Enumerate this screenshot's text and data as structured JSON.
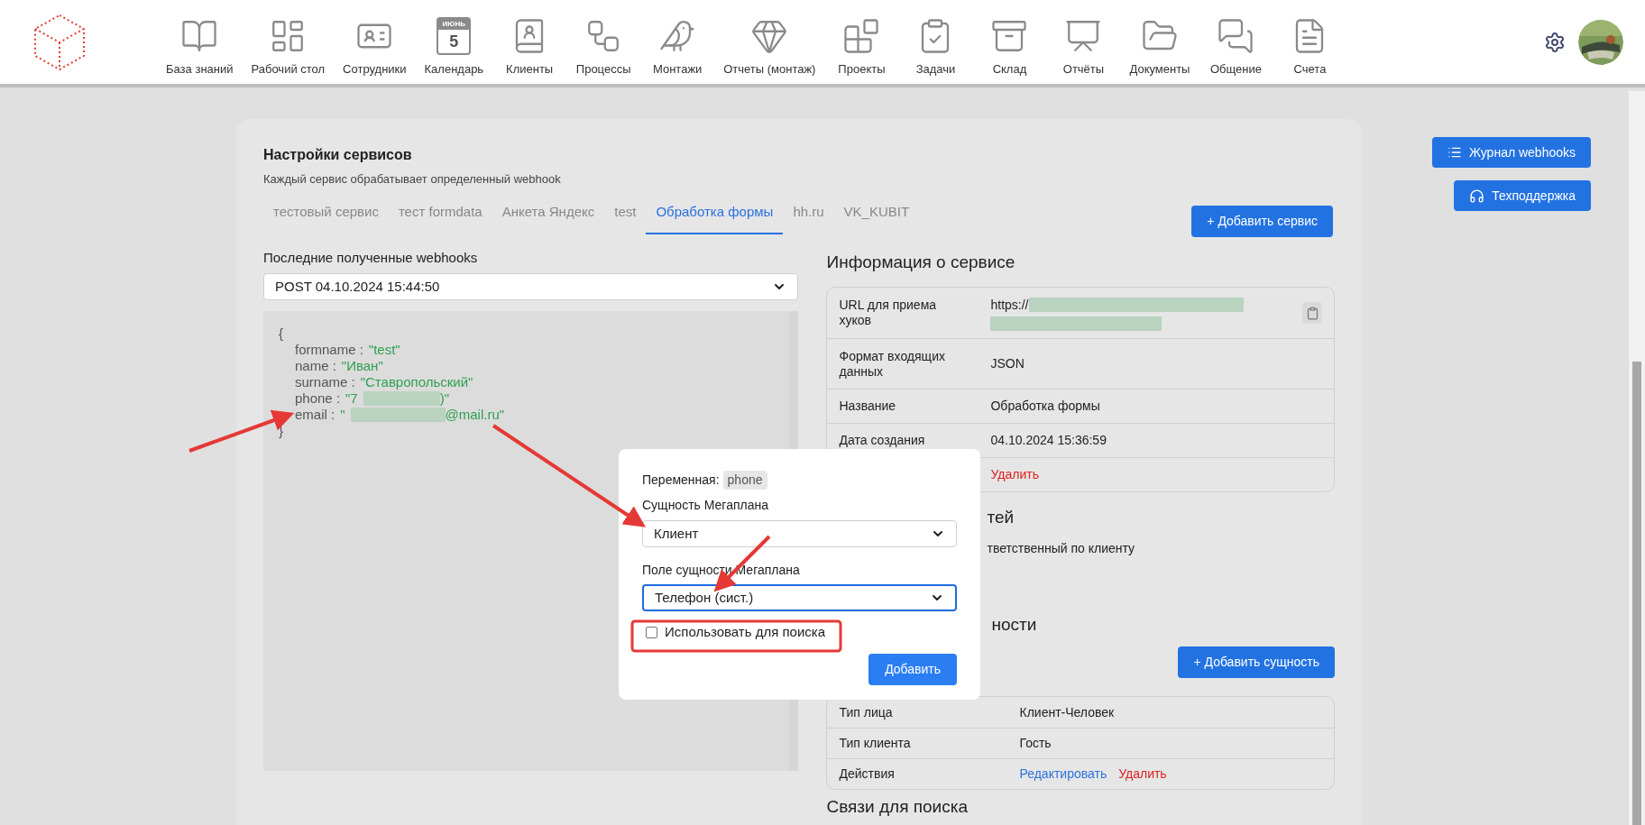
{
  "nav": {
    "items": [
      {
        "label": "База знаний"
      },
      {
        "label": "Рабочий стол"
      },
      {
        "label": "Сотрудники"
      },
      {
        "label": "Календарь",
        "month": "ИЮНЬ",
        "day": "5"
      },
      {
        "label": "Клиенты"
      },
      {
        "label": "Процессы"
      },
      {
        "label": "Монтажи"
      },
      {
        "label": "Отчеты (монтаж)"
      },
      {
        "label": "Проекты"
      },
      {
        "label": "Задачи"
      },
      {
        "label": "Склад"
      },
      {
        "label": "Отчёты"
      },
      {
        "label": "Документы"
      },
      {
        "label": "Общение"
      },
      {
        "label": "Счета"
      }
    ]
  },
  "page": {
    "title": "Настройки сервисов",
    "subtitle": "Каждый сервис обрабатывает определенный webhook",
    "tabs": [
      {
        "label": "тестовый сервис",
        "selected": false
      },
      {
        "label": "тест formdata",
        "selected": false
      },
      {
        "label": "Анкета Яндекс",
        "selected": false
      },
      {
        "label": "test",
        "selected": false
      },
      {
        "label": "Обработка формы",
        "selected": true
      },
      {
        "label": "hh.ru",
        "selected": false
      },
      {
        "label": "VK_KUBIT",
        "selected": false
      }
    ],
    "add_service_button": "+ Добавить сервис"
  },
  "webhooks": {
    "label": "Последние полученные webhooks",
    "selected": "POST 04.10.2024 15:44:50",
    "open": "{",
    "close": "}",
    "lines": [
      {
        "key": "formname :",
        "value": "\"test\"",
        "redacted": false
      },
      {
        "key": "name :",
        "value": "\"Иван\"",
        "redacted": false
      },
      {
        "key": "surname :",
        "value": "\"Ставропольский\"",
        "redacted": false
      },
      {
        "key": "phone :",
        "value": "\"7",
        "value_end": ")\"",
        "redacted": true
      },
      {
        "key": "email :",
        "value": "\"",
        "value_end": "@mail.ru\"",
        "redacted": true
      }
    ]
  },
  "service_info": {
    "title": "Информация о сервисе",
    "rows": [
      {
        "label": "URL для приема хуков",
        "value": "https://",
        "kind": "url"
      },
      {
        "label": "Формат входящих данных",
        "value": "JSON",
        "kind": "text"
      },
      {
        "label": "Название",
        "value": "Обработка формы",
        "kind": "text"
      },
      {
        "label": "Дата создания",
        "value": "04.10.2024 15:36:59",
        "kind": "text"
      },
      {
        "value": "Удалить",
        "kind": "delete"
      }
    ]
  },
  "fields_section": {
    "heading_fragment": "тей",
    "text_fragment": "тветственный по клиенту"
  },
  "entities_section": {
    "heading_fragment": "ности",
    "add_button": "+ Добавить сущность",
    "rows": [
      {
        "label": "Тип лица",
        "value": "Клиент-Человек",
        "kind": "text"
      },
      {
        "label": "Тип клиента",
        "value": "Гость",
        "kind": "text"
      },
      {
        "label": "Действия",
        "edit": "Редактировать",
        "delete": "Удалить",
        "kind": "actions"
      }
    ]
  },
  "search_links_title": "Связи для поиска",
  "side_buttons": [
    {
      "label": "Журнал webhooks",
      "kind": "list"
    },
    {
      "label": "Техподдержка",
      "kind": "support"
    }
  ],
  "modal": {
    "variable_label": "Переменная:",
    "variable": "phone",
    "entity_label": "Сущность Мегаплана",
    "entity": "Клиент",
    "field_label": "Поле сущности Мегаплана",
    "field": "Телефон (сист.)",
    "use_for_search": {
      "label": "Использовать для поиска",
      "checked": false
    },
    "submit": "Добавить"
  }
}
